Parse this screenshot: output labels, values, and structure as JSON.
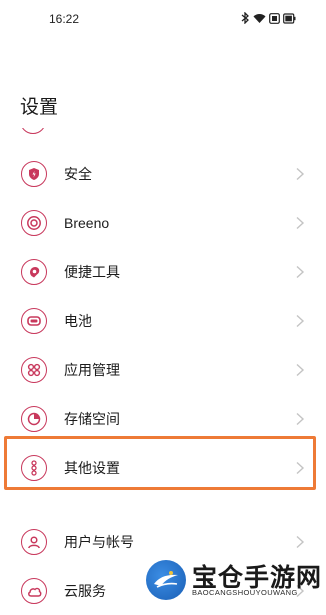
{
  "status_bar": {
    "time": "16:22",
    "icons": [
      "bluetooth-icon",
      "wifi-icon",
      "dnd-icon",
      "battery-icon"
    ]
  },
  "page": {
    "title": "设置"
  },
  "settings": {
    "items": [
      {
        "label": "安全",
        "icon": "shield-icon"
      },
      {
        "label": "Breeno",
        "icon": "breeno-icon"
      },
      {
        "label": "便捷工具",
        "icon": "tools-icon"
      },
      {
        "label": "电池",
        "icon": "battery-icon"
      },
      {
        "label": "应用管理",
        "icon": "apps-icon"
      },
      {
        "label": "存储空间",
        "icon": "storage-icon"
      },
      {
        "label": "其他设置",
        "icon": "more-icon"
      },
      {
        "label": "用户与帐号",
        "icon": "user-icon"
      },
      {
        "label": "云服务",
        "icon": "cloud-icon"
      }
    ]
  },
  "colors": {
    "accent": "#c8385c",
    "highlight": "#ee7a36",
    "chevron": "#c4c4c4"
  },
  "watermark": {
    "title": "宝仓手游网",
    "subtitle": "BAOCANGSHOUYOUWANG"
  }
}
